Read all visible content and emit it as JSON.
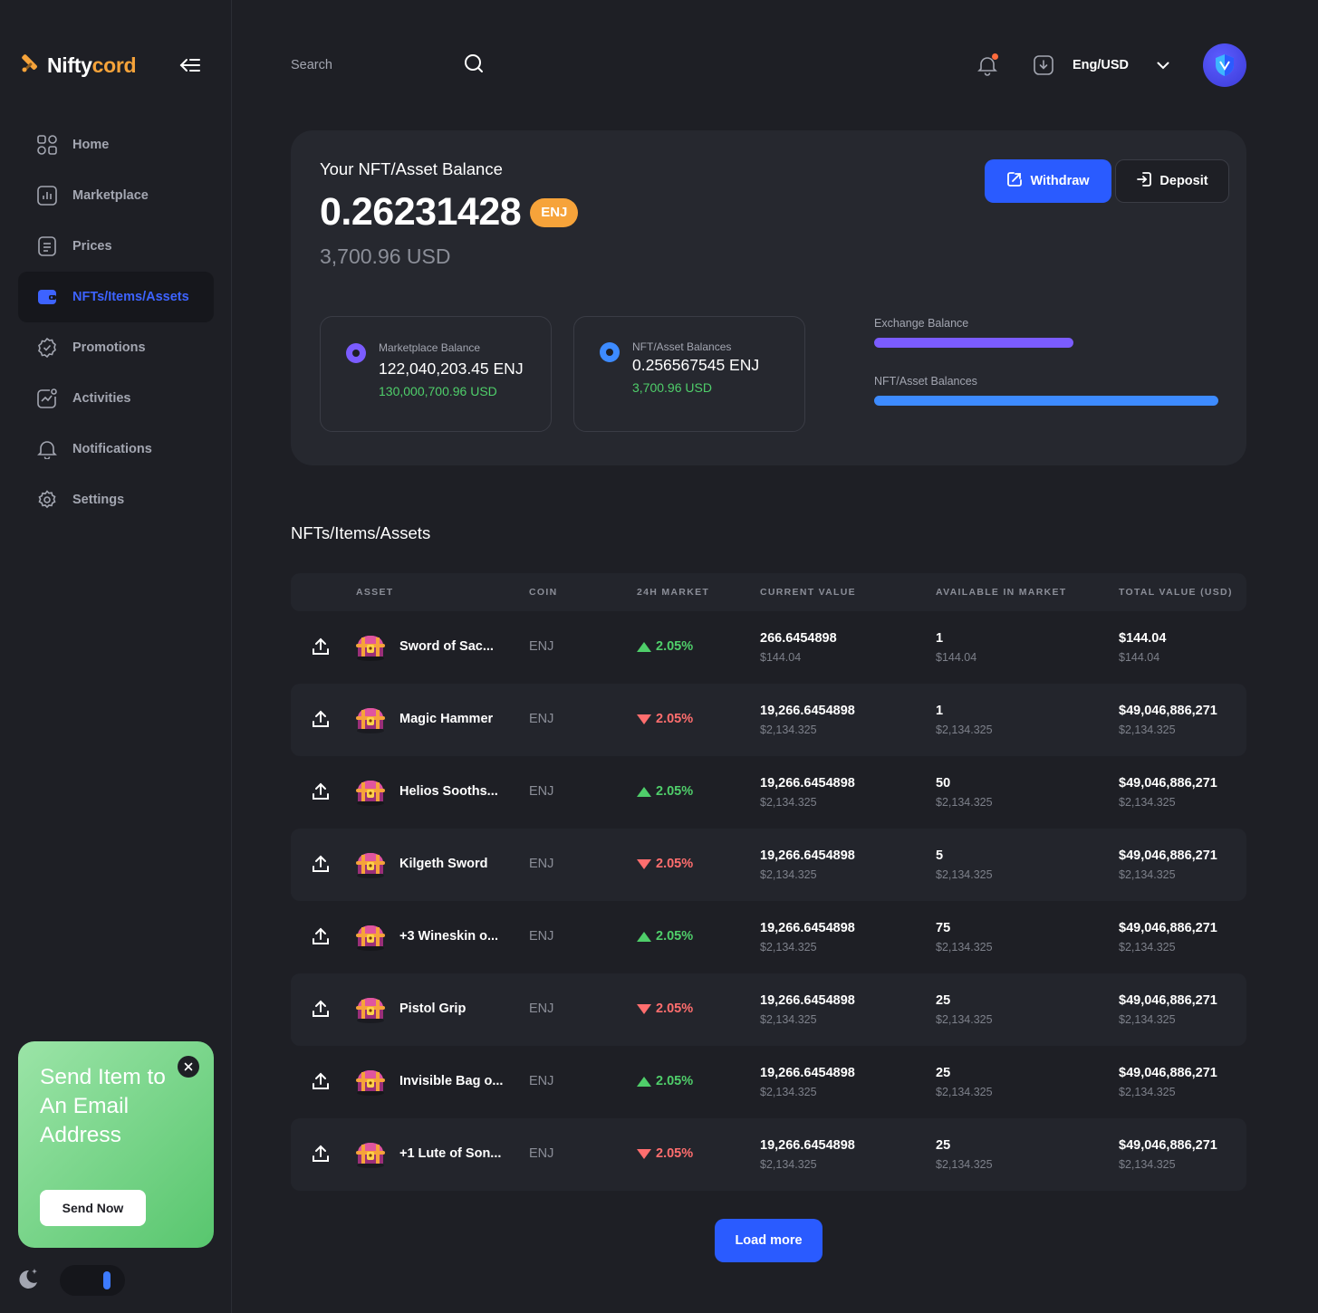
{
  "brand": {
    "name_part1": "Nifty",
    "name_part2": "cord",
    "accent": "#f6a33a"
  },
  "sidebar": {
    "items": [
      {
        "label": "Home",
        "icon": "grid-icon"
      },
      {
        "label": "Marketplace",
        "icon": "chart-icon"
      },
      {
        "label": "Prices",
        "icon": "document-icon"
      },
      {
        "label": "NFTs/Items/Assets",
        "icon": "wallet-icon",
        "active": true
      },
      {
        "label": "Promotions",
        "icon": "badge-icon"
      },
      {
        "label": "Activities",
        "icon": "activity-icon"
      },
      {
        "label": "Notifications",
        "icon": "bell-icon"
      },
      {
        "label": "Settings",
        "icon": "gear-icon"
      }
    ],
    "promo": {
      "title": "Send Item to An Email Address",
      "button": "Send Now"
    }
  },
  "topbar": {
    "search_placeholder": "Search",
    "language": "Eng/USD"
  },
  "balance": {
    "title": "Your NFT/Asset Balance",
    "amount": "0.26231428",
    "currency": "ENJ",
    "usd": "3,700.96 USD",
    "withdraw_label": "Withdraw",
    "deposit_label": "Deposit",
    "cards": [
      {
        "label": "Marketplace Balance",
        "value": "122,040,203.45 ENJ",
        "usd": "130,000,700.96 USD",
        "color": "#7b5cff"
      },
      {
        "label": "NFT/Asset Balances",
        "value": "0.256567545 ENJ",
        "usd": "3,700.96 USD",
        "color": "#3d8bff"
      }
    ],
    "bars": [
      {
        "label": "Exchange Balance",
        "fraction": 0.58,
        "color": "#7b5cff"
      },
      {
        "label": "NFT/Asset Balances",
        "fraction": 1.0,
        "color": "#3d8bff"
      }
    ]
  },
  "table": {
    "title": "NFTs/Items/Assets",
    "headers": [
      "ASSET",
      "COIN",
      "24H MARKET",
      "CURRENT VALUE",
      "AVAILABLE IN MARKET",
      "TOTAL VALUE (USD)"
    ],
    "rows": [
      {
        "name": "Sword of Sac...",
        "coin": "ENJ",
        "change": "2.05%",
        "dir": "up",
        "current": "266.6454898",
        "current_usd": "$144.04",
        "available": "1",
        "available_usd": "$144.04",
        "total": "$144.04",
        "total_sub": "$144.04"
      },
      {
        "name": "Magic Hammer",
        "coin": "ENJ",
        "change": "2.05%",
        "dir": "down",
        "current": "19,266.6454898",
        "current_usd": "$2,134.325",
        "available": "1",
        "available_usd": "$2,134.325",
        "total": "$49,046,886,271",
        "total_sub": "$2,134.325"
      },
      {
        "name": "Helios Sooths...",
        "coin": "ENJ",
        "change": "2.05%",
        "dir": "up",
        "current": "19,266.6454898",
        "current_usd": "$2,134.325",
        "available": "50",
        "available_usd": "$2,134.325",
        "total": "$49,046,886,271",
        "total_sub": "$2,134.325"
      },
      {
        "name": "Kilgeth Sword",
        "coin": "ENJ",
        "change": "2.05%",
        "dir": "down",
        "current": "19,266.6454898",
        "current_usd": "$2,134.325",
        "available": "5",
        "available_usd": "$2,134.325",
        "total": "$49,046,886,271",
        "total_sub": "$2,134.325"
      },
      {
        "name": "+3 Wineskin o...",
        "coin": "ENJ",
        "change": "2.05%",
        "dir": "up",
        "current": "19,266.6454898",
        "current_usd": "$2,134.325",
        "available": "75",
        "available_usd": "$2,134.325",
        "total": "$49,046,886,271",
        "total_sub": "$2,134.325"
      },
      {
        "name": "Pistol Grip",
        "coin": "ENJ",
        "change": "2.05%",
        "dir": "down",
        "current": "19,266.6454898",
        "current_usd": "$2,134.325",
        "available": "25",
        "available_usd": "$2,134.325",
        "total": "$49,046,886,271",
        "total_sub": "$2,134.325"
      },
      {
        "name": "Invisible Bag o...",
        "coin": "ENJ",
        "change": "2.05%",
        "dir": "up",
        "current": "19,266.6454898",
        "current_usd": "$2,134.325",
        "available": "25",
        "available_usd": "$2,134.325",
        "total": "$49,046,886,271",
        "total_sub": "$2,134.325"
      },
      {
        "name": "+1 Lute of Son...",
        "coin": "ENJ",
        "change": "2.05%",
        "dir": "down",
        "current": "19,266.6454898",
        "current_usd": "$2,134.325",
        "available": "25",
        "available_usd": "$2,134.325",
        "total": "$49,046,886,271",
        "total_sub": "$2,134.325"
      }
    ],
    "load_more": "Load more"
  }
}
